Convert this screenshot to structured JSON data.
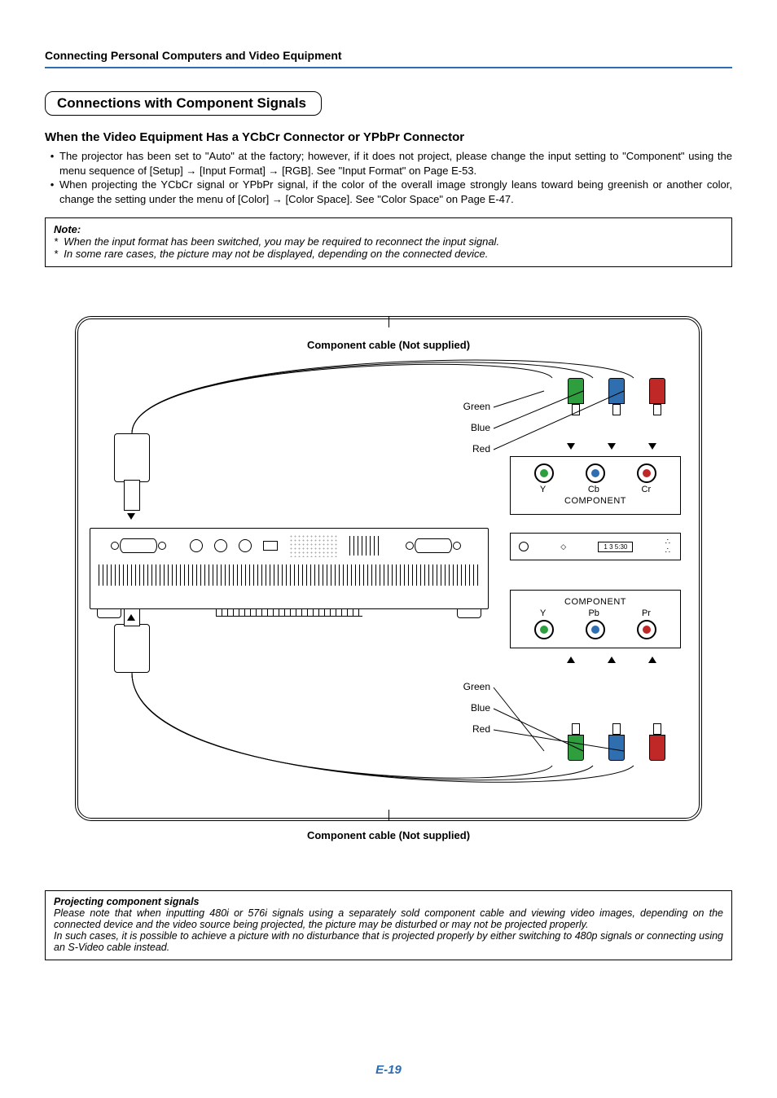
{
  "header": "Connecting Personal Computers and Video Equipment",
  "section_title": "Connections with Component Signals",
  "subheading": "When the Video Equipment Has a YCbCr Connector or YPbPr Connector",
  "bullets": [
    "The projector has been set to \"Auto\" at the factory; however, if it does not project, please change the input setting to \"Component\" using the menu sequence of [Setup] → [Input Format] → [RGB].\nSee \"Input Format\" on Page E-53.",
    "When projecting the YCbCr signal or YPbPr signal, if the color of the overall image strongly leans toward being greenish or another color, change the setting under the menu of [Color] → [Color Space].\nSee \"Color Space\" on Page E-47."
  ],
  "note": {
    "title": "Note:",
    "lines": [
      "When the input format has been switched, you may be required to reconnect the input signal.",
      "In some rare cases, the picture may not be displayed, depending on the connected device."
    ]
  },
  "diagram": {
    "cable_label": "Component cable (Not supplied)",
    "colors": {
      "g": "Green",
      "b": "Blue",
      "r": "Red"
    },
    "top_panel": {
      "labels": [
        "Y",
        "Cb",
        "Cr"
      ],
      "title": "COMPONENT"
    },
    "bot_panel": {
      "labels": [
        "Y",
        "Pb",
        "Pr"
      ],
      "title": "COMPONENT"
    },
    "extra": {
      "box": "1   3   5:30"
    }
  },
  "bottom_note": {
    "title": "Projecting component signals",
    "body": "Please note that when inputting 480i or 576i signals using a separately sold component cable and viewing video images, depending on the connected device and the video source being projected, the picture may be disturbed or may not be projected properly.\nIn such cases, it is possible to achieve a picture with no disturbance that is projected properly by either switching to 480p signals or connecting using an S-Video cable instead."
  },
  "page_number": "E-19"
}
